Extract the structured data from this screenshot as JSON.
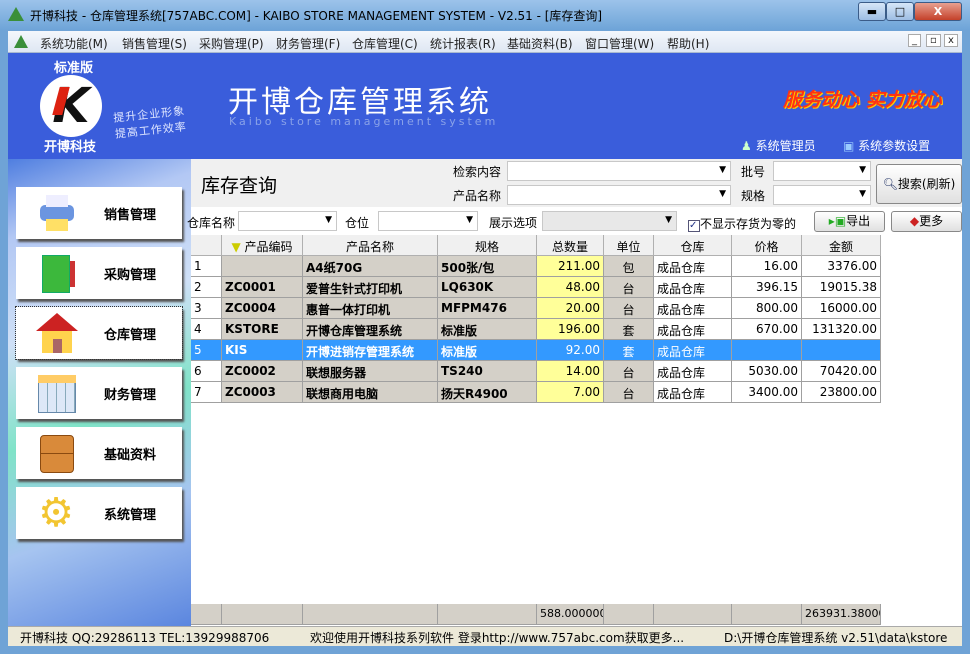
{
  "window": {
    "title": "开博科技 - 仓库管理系统[757ABC.COM] - KAIBO STORE MANAGEMENT SYSTEM - V2.51 - [库存查询]",
    "min": "▬",
    "max": "□",
    "close": "X"
  },
  "menu": [
    "系统功能(M)",
    "销售管理(S)",
    "采购管理(P)",
    "财务管理(F)",
    "仓库管理(C)",
    "统计报表(R)",
    "基础资料(B)",
    "窗口管理(W)",
    "帮助(H)"
  ],
  "banner": {
    "edition": "标准版",
    "company": "开博科技",
    "slogan1": "提升企业形象",
    "slogan2": "提高工作效率",
    "title": "开博仓库管理系统",
    "subtitle": "Kaibo store management system",
    "motto": "服务动心 实力放心",
    "user": "系统管理员",
    "settings": "系统参数设置"
  },
  "sidebar": [
    "销售管理",
    "采购管理",
    "仓库管理",
    "财务管理",
    "基础资料",
    "系统管理"
  ],
  "page": {
    "title": "库存查询",
    "search_label": "检索内容",
    "product_label": "产品名称",
    "batch_label": "批号",
    "spec_label": "规格",
    "search_btn": "搜索(刷新)",
    "warehouse_label": "仓库名称",
    "location_label": "仓位",
    "display_label": "展示选项",
    "hide_zero": "不显示存货为零的",
    "export_btn": "导出",
    "more_btn": "更多"
  },
  "grid": {
    "headers": [
      "",
      "产品编码",
      "产品名称",
      "规格",
      "总数量",
      "单位",
      "仓库",
      "价格",
      "金额"
    ],
    "rows": [
      [
        "1",
        "",
        "A4纸70G",
        "500张/包",
        "211.00",
        "包",
        "成品仓库",
        "16.00",
        "3376.00"
      ],
      [
        "2",
        "ZC0001",
        "爱普生针式打印机",
        "LQ630K",
        "48.00",
        "台",
        "成品仓库",
        "396.15",
        "19015.38"
      ],
      [
        "3",
        "ZC0004",
        "惠普一体打印机",
        "MFPM476",
        "20.00",
        "台",
        "成品仓库",
        "800.00",
        "16000.00"
      ],
      [
        "4",
        "KSTORE",
        "开博仓库管理系统",
        "标准版",
        "196.00",
        "套",
        "成品仓库",
        "670.00",
        "131320.00"
      ],
      [
        "5",
        "KIS",
        "开博进销存管理系统",
        "标准版",
        "92.00",
        "套",
        "成品仓库",
        "",
        ""
      ],
      [
        "6",
        "ZC0002",
        "联想服务器",
        "TS240",
        "14.00",
        "台",
        "成品仓库",
        "5030.00",
        "70420.00"
      ],
      [
        "7",
        "ZC0003",
        "联想商用电脑",
        "扬天R4900",
        "7.00",
        "台",
        "成品仓库",
        "3400.00",
        "23800.00"
      ]
    ],
    "selected_row": 4,
    "totals": {
      "qty": "588.000000",
      "amount": "263931.38000"
    }
  },
  "status": {
    "contact": "开博科技 QQ:29286113 TEL:13929988706",
    "welcome": "欢迎使用开博科技系列软件   登录http://www.757abc.com获取更多...",
    "path": "D:\\开博仓库管理系统 v2.51\\data\\kstore"
  }
}
